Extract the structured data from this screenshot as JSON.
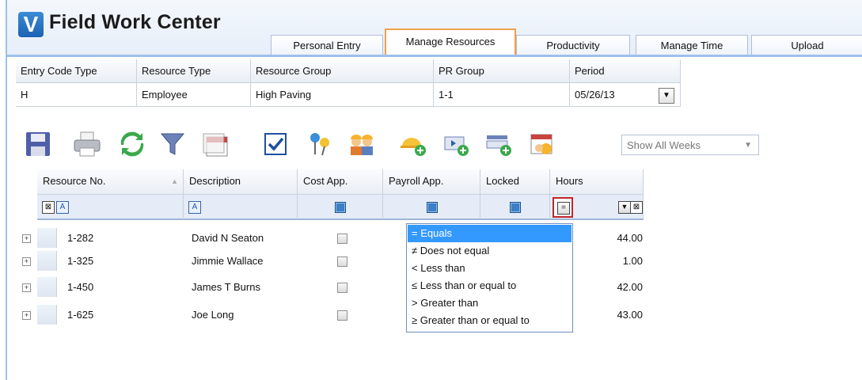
{
  "app": {
    "title": "Field Work Center",
    "logo_letter": "V"
  },
  "tabs": [
    {
      "label": "Personal Entry"
    },
    {
      "label": "Manage Resources",
      "active": true
    },
    {
      "label": "Productivity"
    },
    {
      "label": "Manage Time"
    },
    {
      "label": "Upload"
    }
  ],
  "filters": {
    "headers": [
      "Entry Code Type",
      "Resource Type",
      "Resource Group",
      "PR Group",
      "Period"
    ],
    "values": [
      "H",
      "Employee",
      "High Paving",
      "1-1",
      "05/26/13"
    ]
  },
  "toolbar": {
    "icons": [
      "save-icon",
      "print-icon",
      "refresh-icon",
      "filter-icon",
      "calendar-icon",
      "checkbox-icon",
      "pin-icon",
      "workers-icon",
      "add-worker-icon",
      "add-column-icon",
      "add-row-icon",
      "schedule-icon"
    ],
    "show_weeks": "Show All Weeks"
  },
  "grid": {
    "columns": [
      "Resource No.",
      "Description",
      "Cost App.",
      "Payroll App.",
      "Locked",
      "Hours"
    ],
    "rows": [
      {
        "resource_no": "1-282",
        "description": "David N Seaton",
        "hours": "44.00"
      },
      {
        "resource_no": "1-325",
        "description": "Jimmie Wallace",
        "hours": "1.00"
      },
      {
        "resource_no": "1-450",
        "description": "James T Burns",
        "hours": "42.00"
      },
      {
        "resource_no": "1-625",
        "description": "Joe Long",
        "hours": "43.00"
      }
    ]
  },
  "operator_menu": {
    "items": [
      {
        "symbol": "=",
        "label": "Equals"
      },
      {
        "symbol": "≠",
        "label": "Does not equal"
      },
      {
        "symbol": "<",
        "label": "Less than"
      },
      {
        "symbol": "≤",
        "label": "Less than or equal to"
      },
      {
        "symbol": ">",
        "label": "Greater than"
      },
      {
        "symbol": "≥",
        "label": "Greater than or equal to"
      }
    ]
  },
  "colors": {
    "accent": "#f0a04b",
    "selection": "#3399ff",
    "highlight_border": "#c0262a"
  }
}
